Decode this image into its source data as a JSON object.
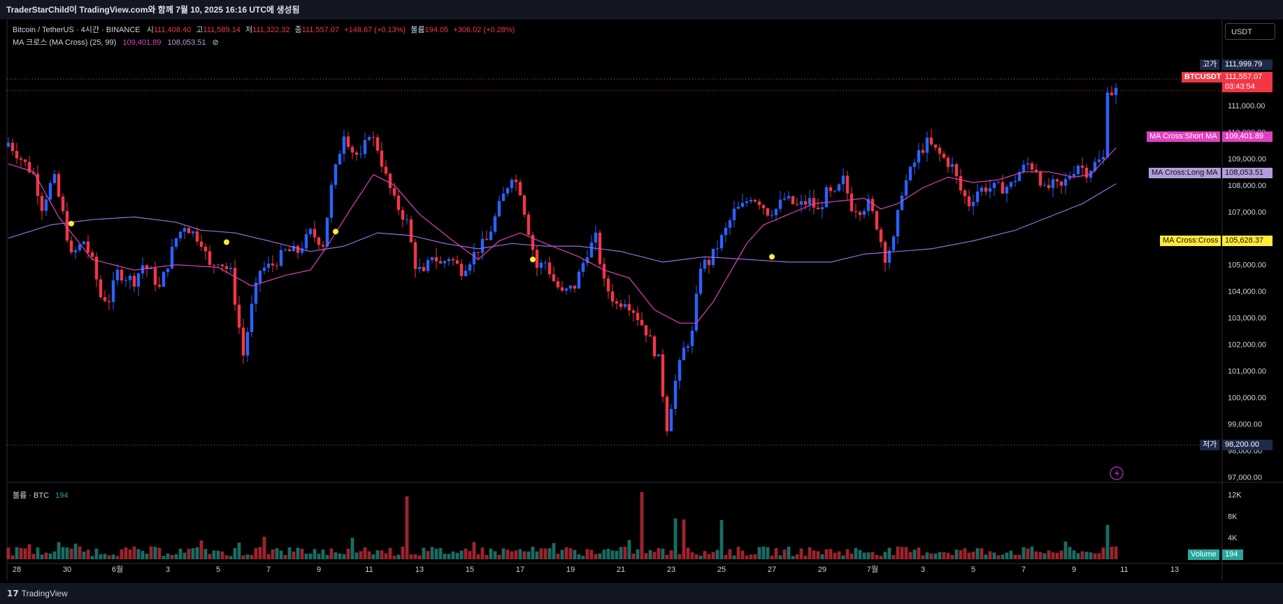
{
  "header": {
    "caption": "TraderStarChild이 TradingView.com와 함께 7월 10, 2025 16:16 UTC에 생성됨"
  },
  "legend": {
    "symbol": "Bitcoin / TetherUS · 4시간 · BINANCE",
    "open_label": "시",
    "open": "111,408.40",
    "high_label": "고",
    "high": "111,589.14",
    "low_label": "저",
    "low": "111,322.32",
    "close_label": "종",
    "close": "111,557.07",
    "change": "+148.67 (+0.13%)",
    "volume_label": "볼륨",
    "volume": "194.05",
    "volume_change": "+306.02 (+0.28%)",
    "indicator": "MA 크로스 (MA Cross) (25, 99)",
    "ma_short": "109,401.89",
    "ma_long": "108,053.51",
    "eye_icon": "⊘"
  },
  "volume_legend": {
    "label": "볼륨 · BTC",
    "value": "194"
  },
  "currency_button": "USDT",
  "price_tags": {
    "high_label": "고가",
    "high_value": "111,999.79",
    "symbol_label": "BTCUSDT",
    "last_price": "111,557.07",
    "countdown": "03:43:54",
    "short_ma_label": "MA Cross:Short MA",
    "short_ma_value": "109,401.89",
    "long_ma_label": "MA Cross:Long MA",
    "long_ma_value": "108,053.51",
    "cross_label": "MA Cross:Cross",
    "cross_value": "105,628.37",
    "low_label": "저가",
    "low_value": "98,200.00",
    "volume_label": "Volume",
    "volume_value": "194"
  },
  "footer": {
    "brand": "TradingView"
  },
  "colors": {
    "up": "#2962ff",
    "down": "#f23645",
    "short_ma": "#e040c0",
    "long_ma": "#9c6ae0",
    "cross": "#ffeb3b",
    "vol_up": "#26a69a",
    "vol_down": "#f23645"
  },
  "chart_data": {
    "type": "candlestick",
    "interval": "4h",
    "price_axis": {
      "range": [
        96800,
        113000
      ],
      "ticks": [
        97000,
        98000,
        99000,
        100000,
        101000,
        102000,
        103000,
        104000,
        105000,
        106000,
        107000,
        108000,
        109000,
        110000,
        111000
      ],
      "tick_labels": [
        "97,000.00",
        "98,000.00",
        "99,000.00",
        "100,000.00",
        "101,000.00",
        "102,000.00",
        "103,000.00",
        "104,000.00",
        "105,000.00",
        "106,000.00",
        "107,000.00",
        "108,000.00",
        "109,000.00",
        "110,000.00",
        "111,000.00"
      ]
    },
    "volume_axis": {
      "range": [
        0,
        13000
      ],
      "ticks": [
        4000,
        8000,
        12000
      ],
      "tick_labels": [
        "4K",
        "8K",
        "12K"
      ]
    },
    "x_labels": [
      "28",
      "30",
      "6월",
      "3",
      "5",
      "7",
      "9",
      "11",
      "13",
      "15",
      "17",
      "19",
      "21",
      "23",
      "25",
      "27",
      "29",
      "7월",
      "3",
      "5",
      "7",
      "9",
      "11",
      "13"
    ],
    "x_label_bars": [
      0,
      12,
      24,
      36,
      48,
      60,
      72,
      84,
      96,
      108,
      120,
      132,
      144,
      156,
      168,
      180,
      192,
      204,
      216,
      228,
      240,
      252,
      264,
      276
    ],
    "last_candle_bar": 264,
    "anchor_closes": [
      [
        0,
        109600
      ],
      [
        4,
        108800
      ],
      [
        6,
        108400
      ],
      [
        8,
        107200
      ],
      [
        10,
        108000
      ],
      [
        11,
        108200
      ],
      [
        13,
        106900
      ],
      [
        15,
        105300
      ],
      [
        18,
        105900
      ],
      [
        20,
        105100
      ],
      [
        22,
        103800
      ],
      [
        24,
        103700
      ],
      [
        26,
        104700
      ],
      [
        30,
        104400
      ],
      [
        32,
        105000
      ],
      [
        34,
        104700
      ],
      [
        36,
        104100
      ],
      [
        40,
        106000
      ],
      [
        42,
        106500
      ],
      [
        46,
        105900
      ],
      [
        48,
        104900
      ],
      [
        50,
        105200
      ],
      [
        53,
        104700
      ],
      [
        56,
        101600
      ],
      [
        58,
        103400
      ],
      [
        60,
        104800
      ],
      [
        63,
        105000
      ],
      [
        66,
        105500
      ],
      [
        69,
        105500
      ],
      [
        72,
        106200
      ],
      [
        75,
        105800
      ],
      [
        77,
        107900
      ],
      [
        80,
        110000
      ],
      [
        82,
        109300
      ],
      [
        84,
        109000
      ],
      [
        86,
        110000
      ],
      [
        88,
        109400
      ],
      [
        90,
        108300
      ],
      [
        92,
        107400
      ],
      [
        95,
        106600
      ],
      [
        97,
        105000
      ],
      [
        99,
        104600
      ],
      [
        101,
        105400
      ],
      [
        103,
        105000
      ],
      [
        105,
        105300
      ],
      [
        108,
        104800
      ],
      [
        110,
        105200
      ],
      [
        112,
        105600
      ],
      [
        114,
        105900
      ],
      [
        117,
        107200
      ],
      [
        120,
        108400
      ],
      [
        122,
        107800
      ],
      [
        124,
        106300
      ],
      [
        126,
        104900
      ],
      [
        128,
        105100
      ],
      [
        130,
        104400
      ],
      [
        132,
        103900
      ],
      [
        135,
        104200
      ],
      [
        138,
        105500
      ],
      [
        140,
        106000
      ],
      [
        142,
        104300
      ],
      [
        145,
        103500
      ],
      [
        147,
        103700
      ],
      [
        149,
        103300
      ],
      [
        152,
        102500
      ],
      [
        155,
        101400
      ],
      [
        157,
        98900
      ],
      [
        159,
        100600
      ],
      [
        161,
        101800
      ],
      [
        163,
        102400
      ],
      [
        165,
        105000
      ],
      [
        167,
        105100
      ],
      [
        169,
        105700
      ],
      [
        171,
        106300
      ],
      [
        173,
        107000
      ],
      [
        175,
        107200
      ],
      [
        177,
        107600
      ],
      [
        179,
        107400
      ],
      [
        181,
        107000
      ],
      [
        183,
        107100
      ],
      [
        185,
        107500
      ],
      [
        188,
        107200
      ],
      [
        191,
        107400
      ],
      [
        193,
        107000
      ],
      [
        195,
        107700
      ],
      [
        197,
        107600
      ],
      [
        199,
        108200
      ],
      [
        201,
        107200
      ],
      [
        203,
        107100
      ],
      [
        205,
        107300
      ],
      [
        207,
        106500
      ],
      [
        209,
        105300
      ],
      [
        211,
        105900
      ],
      [
        213,
        107800
      ],
      [
        215,
        108500
      ],
      [
        217,
        109200
      ],
      [
        219,
        109600
      ],
      [
        221,
        109300
      ],
      [
        223,
        109000
      ],
      [
        225,
        108700
      ],
      [
        227,
        107800
      ],
      [
        229,
        107300
      ],
      [
        231,
        107800
      ],
      [
        233,
        107900
      ],
      [
        235,
        107900
      ],
      [
        237,
        107900
      ],
      [
        239,
        108000
      ],
      [
        241,
        108500
      ],
      [
        243,
        108800
      ],
      [
        245,
        108600
      ],
      [
        247,
        107800
      ],
      [
        249,
        108000
      ],
      [
        251,
        107900
      ],
      [
        253,
        108400
      ],
      [
        255,
        108800
      ],
      [
        257,
        108500
      ],
      [
        259,
        108800
      ],
      [
        261,
        109000
      ],
      [
        262,
        111700
      ],
      [
        263,
        111500
      ],
      [
        264,
        111557
      ]
    ],
    "ma_short_anchors": [
      [
        0,
        108800
      ],
      [
        6,
        108500
      ],
      [
        12,
        106800
      ],
      [
        20,
        105200
      ],
      [
        30,
        104800
      ],
      [
        40,
        105000
      ],
      [
        50,
        104900
      ],
      [
        58,
        104200
      ],
      [
        66,
        104600
      ],
      [
        72,
        104800
      ],
      [
        76,
        105700
      ],
      [
        82,
        107200
      ],
      [
        87,
        108400
      ],
      [
        92,
        108000
      ],
      [
        98,
        106900
      ],
      [
        106,
        105900
      ],
      [
        112,
        105200
      ],
      [
        117,
        105900
      ],
      [
        122,
        106200
      ],
      [
        128,
        105800
      ],
      [
        136,
        105300
      ],
      [
        142,
        104800
      ],
      [
        148,
        104500
      ],
      [
        154,
        103300
      ],
      [
        160,
        102800
      ],
      [
        164,
        102800
      ],
      [
        168,
        103600
      ],
      [
        172,
        104700
      ],
      [
        176,
        105800
      ],
      [
        180,
        106500
      ],
      [
        186,
        106900
      ],
      [
        192,
        107300
      ],
      [
        198,
        107400
      ],
      [
        204,
        107500
      ],
      [
        208,
        107100
      ],
      [
        212,
        107300
      ],
      [
        218,
        107900
      ],
      [
        224,
        108300
      ],
      [
        230,
        108100
      ],
      [
        236,
        108200
      ],
      [
        242,
        108500
      ],
      [
        248,
        108500
      ],
      [
        254,
        108300
      ],
      [
        258,
        108400
      ],
      [
        264,
        109400
      ]
    ],
    "ma_long_anchors": [
      [
        0,
        106000
      ],
      [
        10,
        106500
      ],
      [
        20,
        106700
      ],
      [
        30,
        106800
      ],
      [
        40,
        106600
      ],
      [
        46,
        106300
      ],
      [
        54,
        106200
      ],
      [
        62,
        105900
      ],
      [
        72,
        105500
      ],
      [
        80,
        105700
      ],
      [
        88,
        106200
      ],
      [
        96,
        106100
      ],
      [
        104,
        105800
      ],
      [
        112,
        105600
      ],
      [
        120,
        105800
      ],
      [
        128,
        105700
      ],
      [
        136,
        105700
      ],
      [
        146,
        105500
      ],
      [
        156,
        105100
      ],
      [
        166,
        105300
      ],
      [
        176,
        105200
      ],
      [
        186,
        105100
      ],
      [
        196,
        105100
      ],
      [
        204,
        105400
      ],
      [
        212,
        105500
      ],
      [
        220,
        105600
      ],
      [
        230,
        105900
      ],
      [
        240,
        106300
      ],
      [
        248,
        106800
      ],
      [
        256,
        107300
      ],
      [
        264,
        108050
      ]
    ],
    "cross_points": [
      [
        15,
        106550
      ],
      [
        52,
        105850
      ],
      [
        78,
        106250
      ],
      [
        125,
        105200
      ],
      [
        182,
        105300
      ]
    ],
    "high_line": 111999.79,
    "low_line": 98200.0,
    "current_price_line": 111557.07,
    "volume_spikes": [
      [
        5,
        2800
      ],
      [
        12,
        3200
      ],
      [
        16,
        2900
      ],
      [
        46,
        3500
      ],
      [
        55,
        3100
      ],
      [
        61,
        4200
      ],
      [
        82,
        4000
      ],
      [
        95,
        11700
      ],
      [
        111,
        3200
      ],
      [
        130,
        3000
      ],
      [
        148,
        3600
      ],
      [
        151,
        12500
      ],
      [
        159,
        7600
      ],
      [
        161,
        7400
      ],
      [
        170,
        7300
      ],
      [
        252,
        3300
      ],
      [
        262,
        6400
      ]
    ]
  }
}
